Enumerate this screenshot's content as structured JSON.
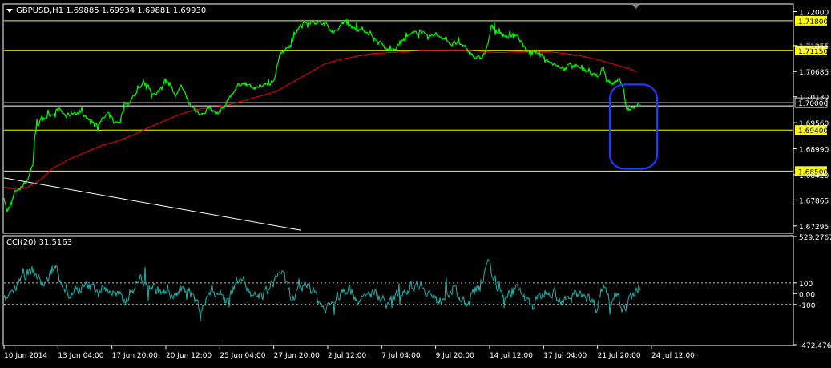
{
  "header": {
    "symbol_text": "GBPUSD,H1  1.69885 1.69934 1.69881 1.69930",
    "indicator_text": "CCI(20) 31.5163"
  },
  "colors": {
    "background": "#000000",
    "frame": "#ffffff",
    "price_line": "#00ff00",
    "ma_line": "#ff0000",
    "cci_line": "#20b2aa",
    "level_line": "#ffff00",
    "highlight_box": "#1e3cff",
    "label_bg": "#ffff00"
  },
  "chart_data": [
    {
      "type": "line",
      "name": "GBPUSD,H1",
      "ylim": [
        1.6715,
        1.7215
      ],
      "y_ticks": [
        1.72,
        1.71255,
        1.70685,
        1.7013,
        1.6956,
        1.6899,
        1.6842,
        1.67865,
        1.67295
      ],
      "x_ticks": [
        "10 Jun 2014",
        "13 Jun 04:00",
        "17 Jun 20:00",
        "20 Jun 12:00",
        "25 Jun 04:00",
        "27 Jun 20:00",
        "2 Jul 12:00",
        "7 Jul 04:00",
        "9 Jul 20:00",
        "14 Jul 12:00",
        "17 Jul 04:00",
        "21 Jul 20:00",
        "24 Jul 12:00"
      ],
      "price_levels": [
        {
          "label": "1.71800",
          "value": 1.718
        },
        {
          "label": "1.71150",
          "value": 1.7115
        },
        {
          "label": "1.70000",
          "value": 1.7
        },
        {
          "label": "1.69400",
          "value": 1.694
        },
        {
          "label": "1.68500",
          "value": 1.685
        }
      ],
      "price_anchors": [
        [
          0,
          1.6795
        ],
        [
          4,
          1.676
        ],
        [
          9,
          1.6775
        ],
        [
          13,
          1.68
        ],
        [
          18,
          1.6812
        ],
        [
          23,
          1.6815
        ],
        [
          30,
          1.6835
        ],
        [
          36,
          1.6865
        ],
        [
          38,
          1.692
        ],
        [
          41,
          1.695
        ],
        [
          48,
          1.6965
        ],
        [
          58,
          1.6975
        ],
        [
          68,
          1.6985
        ],
        [
          78,
          1.697
        ],
        [
          88,
          1.698
        ],
        [
          98,
          1.6975
        ],
        [
          108,
          1.696
        ],
        [
          118,
          1.6955
        ],
        [
          130,
          1.6975
        ],
        [
          138,
          1.6955
        ],
        [
          145,
          1.696
        ],
        [
          150,
          1.6995
        ],
        [
          158,
          1.7005
        ],
        [
          166,
          1.7025
        ],
        [
          174,
          1.7045
        ],
        [
          182,
          1.703
        ],
        [
          190,
          1.7015
        ],
        [
          198,
          1.704
        ],
        [
          206,
          1.705
        ],
        [
          214,
          1.701
        ],
        [
          222,
          1.7035
        ],
        [
          230,
          1.7
        ],
        [
          238,
          1.6985
        ],
        [
          248,
          1.6975
        ],
        [
          256,
          1.699
        ],
        [
          266,
          1.6975
        ],
        [
          276,
          1.6995
        ],
        [
          286,
          1.7025
        ],
        [
          296,
          1.7045
        ],
        [
          306,
          1.704
        ],
        [
          316,
          1.703
        ],
        [
          326,
          1.7045
        ],
        [
          332,
          1.7035
        ],
        [
          338,
          1.706
        ],
        [
          344,
          1.7105
        ],
        [
          352,
          1.7115
        ],
        [
          360,
          1.713
        ],
        [
          366,
          1.7165
        ],
        [
          374,
          1.7175
        ],
        [
          384,
          1.718
        ],
        [
          394,
          1.7175
        ],
        [
          404,
          1.717
        ],
        [
          412,
          1.7155
        ],
        [
          420,
          1.717
        ],
        [
          428,
          1.718
        ],
        [
          436,
          1.7165
        ],
        [
          446,
          1.716
        ],
        [
          456,
          1.7155
        ],
        [
          462,
          1.7135
        ],
        [
          470,
          1.713
        ],
        [
          478,
          1.7115
        ],
        [
          486,
          1.712
        ],
        [
          494,
          1.713
        ],
        [
          504,
          1.7145
        ],
        [
          512,
          1.715
        ],
        [
          520,
          1.716
        ],
        [
          528,
          1.714
        ],
        [
          538,
          1.715
        ],
        [
          548,
          1.7145
        ],
        [
          558,
          1.713
        ],
        [
          566,
          1.713
        ],
        [
          574,
          1.712
        ],
        [
          582,
          1.711
        ],
        [
          588,
          1.71
        ],
        [
          594,
          1.7095
        ],
        [
          600,
          1.711
        ],
        [
          604,
          1.713
        ],
        [
          608,
          1.7165
        ],
        [
          614,
          1.716
        ],
        [
          620,
          1.715
        ],
        [
          630,
          1.7145
        ],
        [
          640,
          1.715
        ],
        [
          648,
          1.7125
        ],
        [
          656,
          1.7105
        ],
        [
          664,
          1.711
        ],
        [
          672,
          1.7105
        ],
        [
          680,
          1.709
        ],
        [
          690,
          1.7085
        ],
        [
          700,
          1.7075
        ],
        [
          710,
          1.7085
        ],
        [
          718,
          1.708
        ],
        [
          726,
          1.707
        ],
        [
          734,
          1.706
        ],
        [
          742,
          1.706
        ],
        [
          748,
          1.708
        ],
        [
          752,
          1.705
        ],
        [
          758,
          1.704
        ],
        [
          764,
          1.7045
        ],
        [
          768,
          1.705
        ],
        [
          771,
          1.704
        ],
        [
          774,
          1.702
        ],
        [
          777,
          1.698
        ],
        [
          782,
          1.6985
        ],
        [
          788,
          1.699
        ],
        [
          794,
          1.6993
        ]
      ],
      "ma_anchors": [
        [
          0,
          1.6815
        ],
        [
          15,
          1.681
        ],
        [
          30,
          1.6815
        ],
        [
          45,
          1.683
        ],
        [
          60,
          1.6855
        ],
        [
          80,
          1.6875
        ],
        [
          100,
          1.689
        ],
        [
          120,
          1.6905
        ],
        [
          140,
          1.6915
        ],
        [
          160,
          1.6928
        ],
        [
          180,
          1.6945
        ],
        [
          200,
          1.696
        ],
        [
          220,
          1.6975
        ],
        [
          240,
          1.6985
        ],
        [
          260,
          1.699
        ],
        [
          280,
          1.6995
        ],
        [
          300,
          1.7005
        ],
        [
          320,
          1.7015
        ],
        [
          340,
          1.7025
        ],
        [
          360,
          1.7045
        ],
        [
          380,
          1.7065
        ],
        [
          400,
          1.7085
        ],
        [
          420,
          1.7095
        ],
        [
          440,
          1.7102
        ],
        [
          460,
          1.7108
        ],
        [
          480,
          1.711
        ],
        [
          500,
          1.7112
        ],
        [
          520,
          1.7115
        ],
        [
          540,
          1.7115
        ],
        [
          560,
          1.7115
        ],
        [
          580,
          1.7115
        ],
        [
          600,
          1.7112
        ],
        [
          620,
          1.711
        ],
        [
          640,
          1.7112
        ],
        [
          660,
          1.7112
        ],
        [
          680,
          1.7112
        ],
        [
          700,
          1.7108
        ],
        [
          720,
          1.7103
        ],
        [
          740,
          1.7095
        ],
        [
          760,
          1.7085
        ],
        [
          780,
          1.7075
        ],
        [
          790,
          1.7068
        ]
      ],
      "trend_line": {
        "from": [
          0,
          1.6835
        ],
        "to": [
          370,
          1.672
        ]
      },
      "annotation": {
        "shape": "rounded-rectangle",
        "x_range": [
          756,
          815
        ],
        "y_range": [
          1.704,
          1.6855
        ]
      }
    },
    {
      "type": "line",
      "name": "CCI(20)",
      "ylim": [
        -472.476,
        529.2767
      ],
      "y_ticks_labels": [
        "529.2767",
        "100",
        "0.00",
        "-100",
        "-472.476"
      ],
      "y_ticks_values": [
        529.2767,
        100,
        0,
        -100,
        -472.476
      ],
      "levels": [
        100,
        -100
      ],
      "seed_anchors": [
        [
          0,
          -80
        ],
        [
          20,
          150
        ],
        [
          36,
          210
        ],
        [
          50,
          80
        ],
        [
          64,
          250
        ],
        [
          80,
          -20
        ],
        [
          100,
          60
        ],
        [
          130,
          40
        ],
        [
          150,
          -70
        ],
        [
          170,
          140
        ],
        [
          190,
          40
        ],
        [
          210,
          -30
        ],
        [
          230,
          60
        ],
        [
          245,
          -150
        ],
        [
          260,
          40
        ],
        [
          280,
          -50
        ],
        [
          295,
          200
        ],
        [
          310,
          -60
        ],
        [
          330,
          30
        ],
        [
          345,
          220
        ],
        [
          360,
          -60
        ],
        [
          380,
          100
        ],
        [
          400,
          -150
        ],
        [
          415,
          -40
        ],
        [
          430,
          60
        ],
        [
          445,
          -80
        ],
        [
          460,
          20
        ],
        [
          480,
          -90
        ],
        [
          500,
          40
        ],
        [
          520,
          100
        ],
        [
          540,
          -80
        ],
        [
          560,
          50
        ],
        [
          575,
          -100
        ],
        [
          590,
          30
        ],
        [
          605,
          260
        ],
        [
          620,
          -20
        ],
        [
          640,
          40
        ],
        [
          660,
          -110
        ],
        [
          680,
          60
        ],
        [
          700,
          -80
        ],
        [
          720,
          30
        ],
        [
          740,
          -120
        ],
        [
          748,
          100
        ],
        [
          756,
          -60
        ],
        [
          766,
          40
        ],
        [
          772,
          -150
        ],
        [
          778,
          -100
        ],
        [
          786,
          0
        ],
        [
          794,
          31.5
        ]
      ]
    }
  ]
}
